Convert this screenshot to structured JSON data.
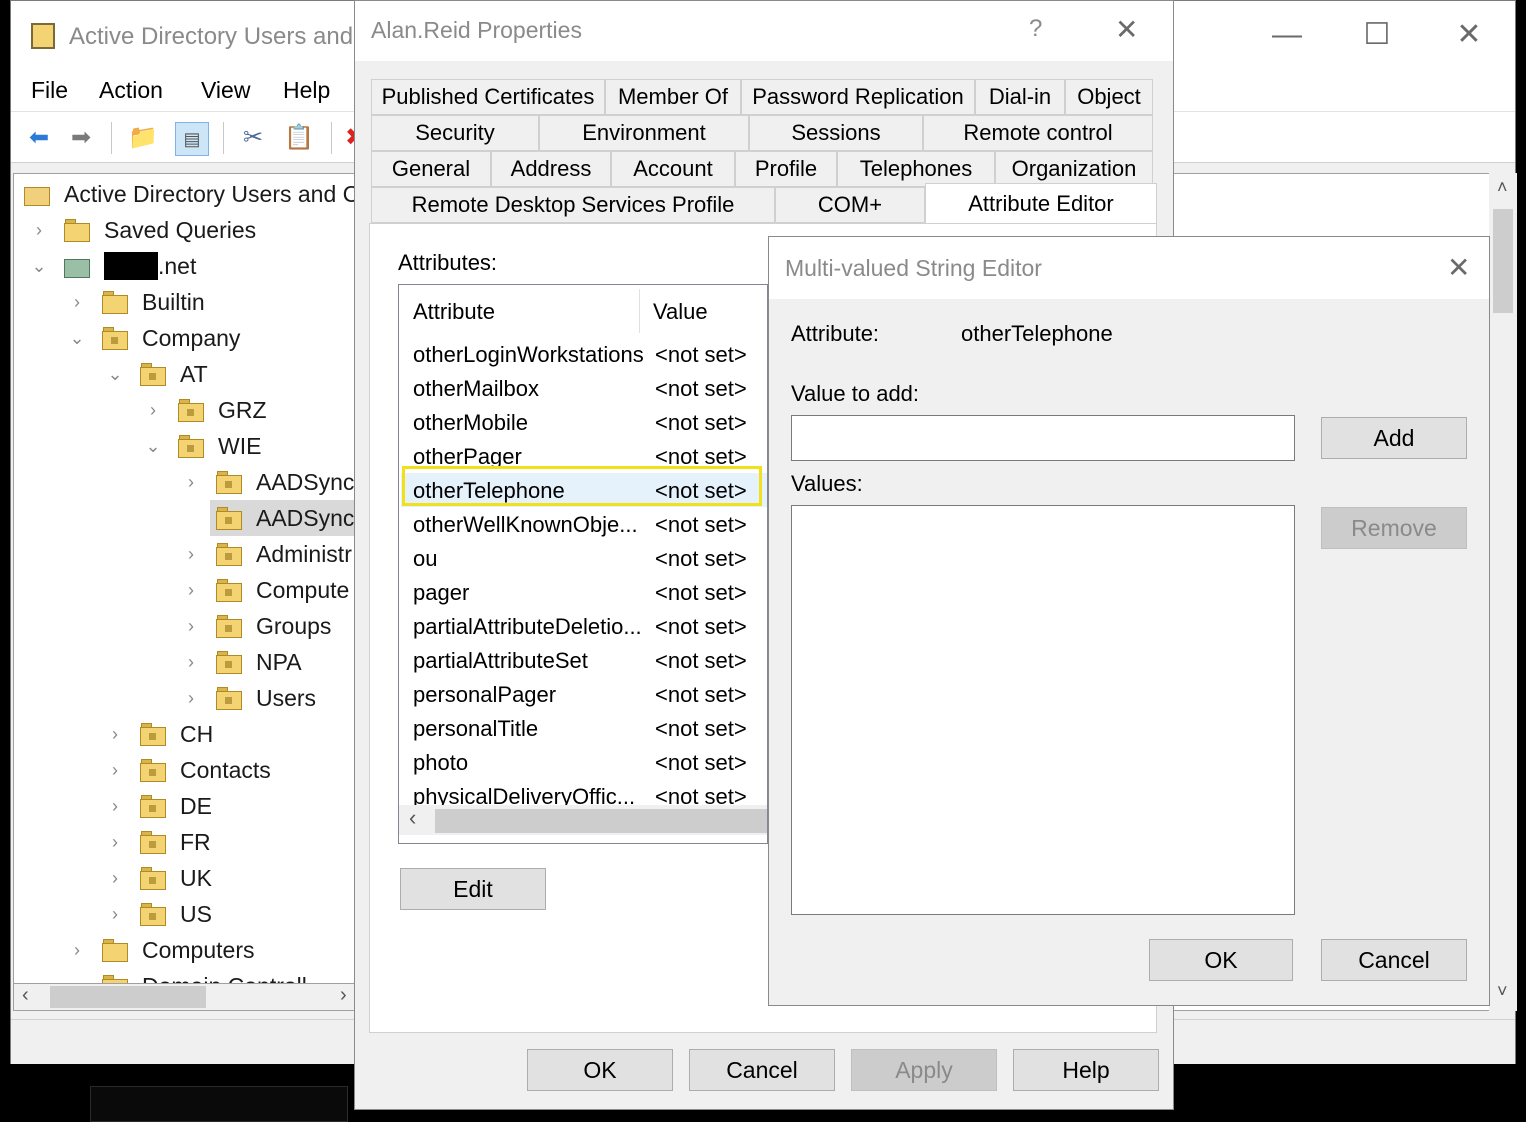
{
  "main_window": {
    "title": "Active Directory Users and C",
    "controls": {
      "minimize": "—",
      "maximize": "☐",
      "close": "✕"
    },
    "menu": [
      "File",
      "Action",
      "View",
      "Help"
    ]
  },
  "tree": {
    "root": "Active Directory Users and C",
    "items": [
      {
        "label": "Saved Queries",
        "expander": "›"
      },
      {
        "label": ".net",
        "expander": "⌄"
      },
      {
        "label": "Builtin",
        "expander": "›"
      },
      {
        "label": "Company",
        "expander": "⌄"
      },
      {
        "label": "AT",
        "expander": "⌄"
      },
      {
        "label": "GRZ",
        "expander": "›"
      },
      {
        "label": "WIE",
        "expander": "⌄"
      },
      {
        "label": "AADSync_",
        "expander": "›"
      },
      {
        "label": "AADSync_",
        "expander": ""
      },
      {
        "label": "Administr",
        "expander": "›"
      },
      {
        "label": "Compute",
        "expander": "›"
      },
      {
        "label": "Groups",
        "expander": "›"
      },
      {
        "label": "NPA",
        "expander": "›"
      },
      {
        "label": "Users",
        "expander": "›"
      },
      {
        "label": "CH",
        "expander": "›"
      },
      {
        "label": "Contacts",
        "expander": "›"
      },
      {
        "label": "DE",
        "expander": "›"
      },
      {
        "label": "FR",
        "expander": "›"
      },
      {
        "label": "UK",
        "expander": "›"
      },
      {
        "label": "US",
        "expander": "›"
      },
      {
        "label": "Computers",
        "expander": "›"
      },
      {
        "label": "Domain Controll",
        "expander": "›"
      }
    ]
  },
  "props": {
    "title": "Alan.Reid Properties",
    "help": "?",
    "close": "✕",
    "tabs_row1": [
      "Published Certificates",
      "Member Of",
      "Password Replication",
      "Dial-in",
      "Object"
    ],
    "tabs_row2": [
      "Security",
      "Environment",
      "Sessions",
      "Remote control"
    ],
    "tabs_row3": [
      "General",
      "Address",
      "Account",
      "Profile",
      "Telephones",
      "Organization"
    ],
    "tabs_row4": [
      "Remote Desktop Services Profile",
      "COM+",
      "Attribute Editor"
    ],
    "attributes_label": "Attributes:",
    "columns": {
      "attribute": "Attribute",
      "value": "Value"
    },
    "rows": [
      {
        "name": "otherLoginWorkstations",
        "value": "<not set>"
      },
      {
        "name": "otherMailbox",
        "value": "<not set>"
      },
      {
        "name": "otherMobile",
        "value": "<not set>"
      },
      {
        "name": "otherPager",
        "value": "<not set>"
      },
      {
        "name": "otherTelephone",
        "value": "<not set>"
      },
      {
        "name": "otherWellKnownObje...",
        "value": "<not set>"
      },
      {
        "name": "ou",
        "value": "<not set>"
      },
      {
        "name": "pager",
        "value": "<not set>"
      },
      {
        "name": "partialAttributeDeletio...",
        "value": "<not set>"
      },
      {
        "name": "partialAttributeSet",
        "value": "<not set>"
      },
      {
        "name": "personalPager",
        "value": "<not set>"
      },
      {
        "name": "personalTitle",
        "value": "<not set>"
      },
      {
        "name": "photo",
        "value": "<not set>"
      },
      {
        "name": "physicalDeliveryOffic...",
        "value": "<not set>"
      }
    ],
    "edit": "Edit",
    "buttons": {
      "ok": "OK",
      "cancel": "Cancel",
      "apply": "Apply",
      "help": "Help"
    },
    "highlight_color": "#f0e11a"
  },
  "mv_editor": {
    "title": "Multi-valued String Editor",
    "close": "✕",
    "attribute_label": "Attribute:",
    "attribute_value": "otherTelephone",
    "value_to_add_label": "Value to add:",
    "value_to_add": "",
    "values_label": "Values:",
    "add": "Add",
    "remove": "Remove",
    "ok": "OK",
    "cancel": "Cancel"
  }
}
